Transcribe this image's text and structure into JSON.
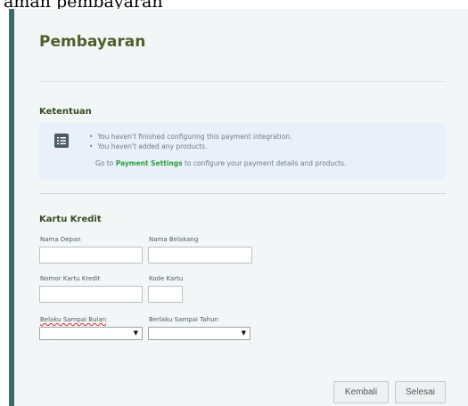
{
  "caption": "aman pembayaran",
  "page": {
    "title": "Pembayaran"
  },
  "terms": {
    "heading": "Ketentuan",
    "icon": "list-icon",
    "messages": [
      "You haven't finished configuring this payment integration.",
      "You haven't added any products."
    ],
    "goto_prefix": "Go to ",
    "goto_link": "Payment Settings",
    "goto_suffix": " to configure your payment details and products."
  },
  "credit_card": {
    "heading": "Kartu Kredit",
    "first_name": {
      "label": "Nama Depan",
      "value": ""
    },
    "last_name": {
      "label": "Nama Belakang",
      "value": ""
    },
    "card_number": {
      "label": "Nomor Kartu Kredit",
      "value": ""
    },
    "card_code": {
      "label": "Kode Kartu",
      "value": ""
    },
    "valid_month": {
      "label": "Belaku Sampai Bulan",
      "value": ""
    },
    "valid_year": {
      "label": "Berlaku Sampai Tahun",
      "value": ""
    }
  },
  "buttons": {
    "back": "Kembali",
    "finish": "Selesai"
  },
  "colors": {
    "accent_bar": "#3d6b6b",
    "title": "#4e5f2a",
    "link": "#2ba03b",
    "panel_bg": "#f2f6f7",
    "info_bg": "#eaf0fa"
  }
}
